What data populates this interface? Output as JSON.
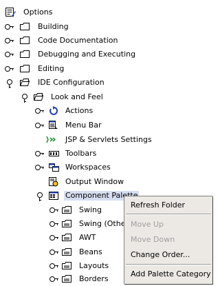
{
  "tree": {
    "root_label": "Options",
    "building": "Building",
    "code_documentation": "Code Documentation",
    "debugging_executing": "Debugging and Executing",
    "editing": "Editing",
    "ide_configuration": "IDE Configuration",
    "look_and_feel": "Look and Feel",
    "actions": "Actions",
    "menu_bar": "Menu Bar",
    "jsp_servlets": "JSP & Servlets Settings",
    "toolbars": "Toolbars",
    "workspaces": "Workspaces",
    "output_window": "Output Window",
    "component_palette": "Component Palette",
    "swing": "Swing",
    "swing_other": "Swing (Other",
    "awt": "AWT",
    "beans": "Beans",
    "layouts": "Layouts",
    "borders": "Borders"
  },
  "context_menu": {
    "refresh_folder": "Refresh Folder",
    "move_up": "Move Up",
    "move_down": "Move Down",
    "change_order": "Change Order...",
    "add_palette_category": "Add Palette Category"
  },
  "colors": {
    "selection": "#d6def0",
    "menu_bg": "#ece9e4",
    "disabled_text": "#a0a0a0"
  }
}
